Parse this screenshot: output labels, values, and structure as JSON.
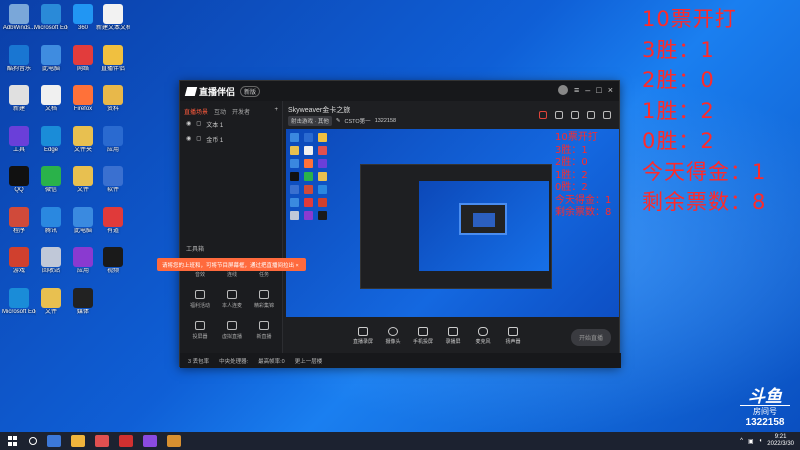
{
  "desktop_icons": [
    {
      "label": "AdbWinds...",
      "color": "#7aa7d9"
    },
    {
      "label": "Microsoft Edge",
      "color": "#2a8ad8"
    },
    {
      "label": "360",
      "color": "#2196f3"
    },
    {
      "label": "新建文本文档",
      "color": "#f2f2f2"
    },
    {
      "label": "酷狗音乐",
      "color": "#1976d2"
    },
    {
      "label": "此电脑",
      "color": "#3f8ce0"
    },
    {
      "label": "网络",
      "color": "#e23c3c"
    },
    {
      "label": "直播伴侣",
      "color": "#f0c040"
    },
    {
      "label": "新建",
      "color": "#e0e0e0"
    },
    {
      "label": "文档",
      "color": "#f0f0f0"
    },
    {
      "label": "Firefox",
      "color": "#ff7139"
    },
    {
      "label": "资料",
      "color": "#e8b84a"
    },
    {
      "label": "工具",
      "color": "#6a3fd9"
    },
    {
      "label": "Edge",
      "color": "#1a8cd8"
    },
    {
      "label": "文件夹",
      "color": "#e8c050"
    },
    {
      "label": "应用",
      "color": "#2a6ad0"
    },
    {
      "label": "QQ",
      "color": "#111111"
    },
    {
      "label": "微信",
      "color": "#2ab24a"
    },
    {
      "label": "文件",
      "color": "#e8c050"
    },
    {
      "label": "软件",
      "color": "#3a70d0"
    },
    {
      "label": "程序",
      "color": "#d04a3a"
    },
    {
      "label": "腾讯",
      "color": "#2a88e0"
    },
    {
      "label": "此电脑",
      "color": "#3a8ae0"
    },
    {
      "label": "有道",
      "color": "#e03a3a"
    },
    {
      "label": "游戏",
      "color": "#d0402e"
    },
    {
      "label": "回收站",
      "color": "#c0c8d8"
    },
    {
      "label": "应用",
      "color": "#8a3ad0"
    },
    {
      "label": "视频",
      "color": "#1a1a1a"
    },
    {
      "label": "Microsoft Edge",
      "color": "#1a8cd8"
    },
    {
      "label": "文件",
      "color": "#e8c050"
    },
    {
      "label": "媒体",
      "color": "#222222"
    }
  ],
  "overlay": {
    "lines": [
      "10票开打",
      "3胜：1",
      "2胜：0",
      "1胜：2",
      "0胜：2",
      "今天得金：1",
      "剩余票数：8"
    ]
  },
  "app": {
    "name": "直播伴侣",
    "version_badge": "新版",
    "tabs": [
      "直播场景",
      "互动",
      "开发者"
    ],
    "active_tab": 0,
    "scenes": [
      "文本 1",
      "金币 1"
    ],
    "tool_header": "工具箱",
    "tools": [
      "音效",
      "连线",
      "任务",
      "福利活动",
      "本人连麦",
      "精彩集锦",
      "投屏器",
      "虚拟直播",
      "新直播"
    ],
    "stream_title": "Skyweaver金卡之旅",
    "tags": [
      "射击游戏 · 其他",
      "CSTO第一",
      "1322158"
    ],
    "toolbar": [
      "直播录屏",
      "摄像头",
      "手机投屏",
      "录播屏",
      "麦克风",
      "扬声器"
    ],
    "live_button": "开始直播",
    "toast": "请将您的上班和，可将节目屏幕框，通过把直播间拉出 ×",
    "status": [
      "3 丢包率",
      "中央处理器:",
      "最高帧率:0",
      "更上一层楼"
    ]
  },
  "preview_overlay": {
    "lines": [
      "10票开打",
      "3胜：1",
      "2胜：0",
      "1胜：2",
      "0胜：2",
      "今天得金：1",
      "剩余票数：8"
    ]
  },
  "watermark": {
    "logo": "斗鱼",
    "room_label": "房间号",
    "room_number": "1322158"
  },
  "taskbar": {
    "time": "9:21",
    "date": "2022/3/30",
    "apps": [
      "#3c78d8",
      "#f0b43c",
      "#e05050",
      "#d03030",
      "#8a4ae0",
      "#d89030"
    ]
  }
}
